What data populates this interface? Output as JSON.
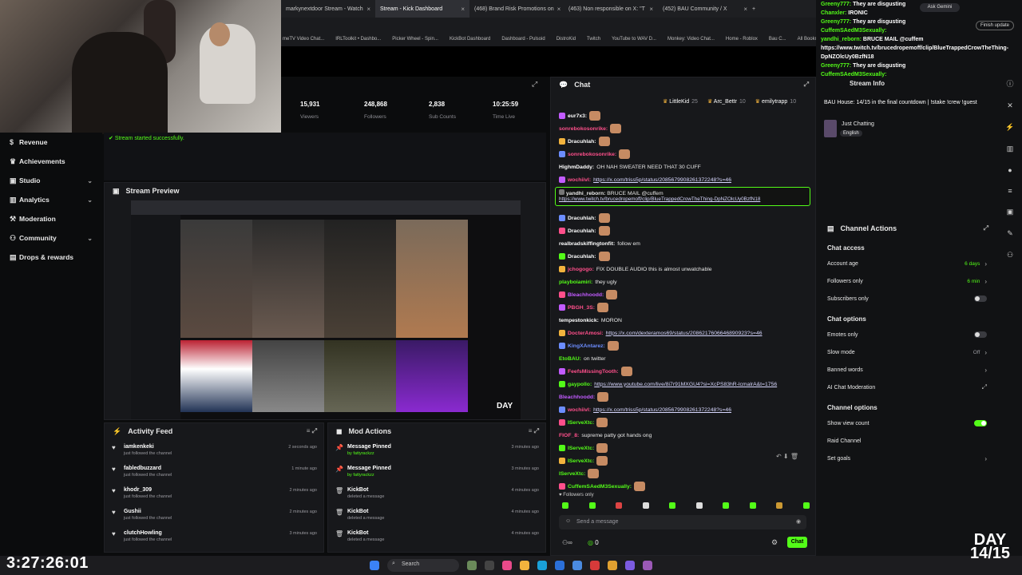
{
  "browser": {
    "tabs": [
      {
        "label": "markynextdoor Stream - Watch",
        "active": false
      },
      {
        "label": "Stream - Kick Dashboard",
        "active": true
      },
      {
        "label": "(468) Brand Risk Promotions on",
        "active": false
      },
      {
        "label": "(463) Non responsible on X: \"T",
        "active": false
      },
      {
        "label": "(452) BAU Community / X",
        "active": false
      }
    ],
    "bookmarks": [
      "meTV Video Chat...",
      "IRLToolkit • Dashbo...",
      "Picker Wheel - Spin...",
      "KickBot Dashboard",
      "Dashboard - Pulsoid",
      "DistroKid",
      "Twitch",
      "YouTube to WAV D...",
      "Monkey: Video Chat...",
      "Home - Roblox",
      "Bau C...",
      "All Bookmarks"
    ],
    "ask_gemini": "Ask Gemini",
    "finish_update": "Finish update"
  },
  "sidebar": {
    "items": [
      {
        "label": "Revenue",
        "icon": "dollar-icon",
        "chevron": false
      },
      {
        "label": "Achievements",
        "icon": "trophy-icon",
        "chevron": false
      },
      {
        "label": "Studio",
        "icon": "studio-icon",
        "chevron": true
      },
      {
        "label": "Analytics",
        "icon": "chart-icon",
        "chevron": true
      },
      {
        "label": "Moderation",
        "icon": "hammer-icon",
        "chevron": false
      },
      {
        "label": "Community",
        "icon": "people-icon",
        "chevron": true
      },
      {
        "label": "Drops & rewards",
        "icon": "gift-icon",
        "chevron": false
      }
    ]
  },
  "stats": [
    {
      "value": "15,931",
      "label": "Viewers"
    },
    {
      "value": "248,868",
      "label": "Followers"
    },
    {
      "value": "2,838",
      "label": "Sub Counts"
    },
    {
      "value": "10:25:59",
      "label": "Time Live"
    }
  ],
  "toast": "Stream started successfully.",
  "preview": {
    "title": "Stream Preview",
    "day": "DAY"
  },
  "activity": {
    "title": "Activity Feed",
    "items": [
      {
        "name": "iamkenkeki",
        "sub": "just followed the channel",
        "time": "2 seconds ago"
      },
      {
        "name": "fabledbuzzard",
        "sub": "just followed the channel",
        "time": "1 minute ago"
      },
      {
        "name": "khodr_309",
        "sub": "just followed the channel",
        "time": "2 minutes ago"
      },
      {
        "name": "Gushii",
        "sub": "just followed the channel",
        "time": "2 minutes ago"
      },
      {
        "name": "clutchHowling",
        "sub": "just followed the channel",
        "time": "3 minutes ago"
      }
    ]
  },
  "mod": {
    "title": "Mod Actions",
    "items": [
      {
        "name": "Message Pinned",
        "sub": "by fattyrackzz",
        "time": "3 minutes ago",
        "icon": "pin-icon",
        "subgreen": true
      },
      {
        "name": "Message Pinned",
        "sub": "by fattyrackzz",
        "time": "3 minutes ago",
        "icon": "pin-icon",
        "subgreen": true
      },
      {
        "name": "KickBot",
        "sub": "deleted a message",
        "time": "4 minutes ago",
        "icon": "trash-icon",
        "subgreen": false
      },
      {
        "name": "KickBot",
        "sub": "deleted a message",
        "time": "4 minutes ago",
        "icon": "trash-icon",
        "subgreen": false
      },
      {
        "name": "KickBot",
        "sub": "deleted a message",
        "time": "4 minutes ago",
        "icon": "trash-icon",
        "subgreen": false
      }
    ]
  },
  "chat": {
    "title": "Chat",
    "top_users": [
      {
        "name": "LittleKid",
        "count": "25"
      },
      {
        "name": "Arc_Bettr",
        "count": "10"
      },
      {
        "name": "emilytrapp",
        "count": "10"
      }
    ],
    "messages": [
      {
        "user": "eur7x3:",
        "color": "#ffffff",
        "text": "",
        "emoji": true
      },
      {
        "user": "sonrebokosonrike:",
        "color": "#ff4f8b",
        "text": "",
        "emoji": true
      },
      {
        "user": "Dracuhlah:",
        "color": "#ffffff",
        "text": "",
        "emoji": true
      },
      {
        "user": "sonrebokosonrike:",
        "color": "#ff4f8b",
        "text": "",
        "emoji": true
      },
      {
        "user": "HighmDaddy:",
        "color": "#ffffff",
        "text": "OH NAH SWEATER NEED THAT 30 CUFF",
        "emoji": false
      },
      {
        "user": "wochiivl:",
        "color": "#ff4f8b",
        "text": "https://x.com/triss5p/status/2085679908261372248?s=46",
        "link": true
      },
      {
        "user": "",
        "color": "#ffffff",
        "text": "",
        "spacer": true
      },
      {
        "user": "",
        "color": "#ffffff",
        "text": "",
        "spacer": true
      },
      {
        "user": "Dracuhlah:",
        "color": "#ffffff",
        "text": "",
        "emoji": true
      },
      {
        "user": "Dracuhlah:",
        "color": "#ffffff",
        "text": "",
        "emoji": true
      },
      {
        "user": "realbradskiffingtonfit:",
        "color": "#ffffff",
        "text": "follow em"
      },
      {
        "user": "Dracuhlah:",
        "color": "#ffffff",
        "text": "",
        "emoji": true
      },
      {
        "user": "jchogogo:",
        "color": "#ff4f8b",
        "text": "FIX DOUBLE AUDIO this is almost unwatchable"
      },
      {
        "user": "playboiamiri:",
        "color": "#53fc18",
        "text": "they ugly"
      },
      {
        "user": "Bleachhoodd:",
        "color": "#c25bff",
        "text": "",
        "emoji": true
      },
      {
        "user": "PBGH_3S:",
        "color": "#ff4f8b",
        "text": "",
        "emoji": true
      },
      {
        "user": "tempestonkick:",
        "color": "#ffffff",
        "text": "MORON"
      },
      {
        "user": "DocterAmosi:",
        "color": "#ff4f8b",
        "text": "https://x.com/dexteramos69/status/2086217606646890923?s=46",
        "link": true
      },
      {
        "user": "KingXAntarez:",
        "color": "#6c8dff",
        "text": "",
        "emoji": true
      },
      {
        "user": "EtoBAU:",
        "color": "#53fc18",
        "text": "on twitter"
      },
      {
        "user": "FeefsMissingTooth:",
        "color": "#ff4f8b",
        "text": "",
        "emoji": true
      },
      {
        "user": "gaypollo:",
        "color": "#53fc18",
        "text": "https://www.youtube.com/live/8i7r91MXGU4?si=XcPS83hR-lcmalrA&t=1756",
        "link": true
      },
      {
        "user": "Bleachhoodd:",
        "color": "#c25bff",
        "text": "",
        "emoji": true
      },
      {
        "user": "wochiivl:",
        "color": "#ff4f8b",
        "text": "https://x.com/triss5p/status/2085679908261372248?s=46",
        "link": true
      },
      {
        "user": "IServeXtc:",
        "color": "#53fc18",
        "text": "",
        "emoji": true
      },
      {
        "user": "FIOF_8:",
        "color": "#ff4f8b",
        "text": "supreme patty got hands ong"
      },
      {
        "user": "IServeXtc:",
        "color": "#53fc18",
        "text": "",
        "emoji": true
      },
      {
        "user": "IServeXtc:",
        "color": "#53fc18",
        "text": "",
        "emoji": true
      },
      {
        "user": "IServeXtc:",
        "color": "#53fc18",
        "text": "",
        "emoji": true
      },
      {
        "user": "CuffemSAedM3Sexually:",
        "color": "#53fc18",
        "text": "",
        "emoji": true
      }
    ],
    "pinned": {
      "user": "yandhi_reborn:",
      "text": "BRUCE MAIL @cuffem",
      "link": "https://www.twitch.tv/brucedropemoff/clip/BlueTrappedCrowTheThing-DpNZOlcUy0BzfN18"
    },
    "followers_only": "Followers only",
    "input_placeholder": "Send a message",
    "count": "0",
    "send_label": "Chat"
  },
  "stream_info": {
    "title": "Stream Info",
    "desc": "BAU House: 14/15 in the final countdown | !stake !crew !guest",
    "category": "Just Chatting",
    "lang": "English"
  },
  "overlay_chat": [
    {
      "user": "Greeny777:",
      "text": "They are disgusting"
    },
    {
      "user": "Chanxler:",
      "text": "IRONIC"
    },
    {
      "user": "Greeny777:",
      "text": "They are disgusting"
    },
    {
      "user": "CuffemSAedM3Sexually:",
      "text": ""
    },
    {
      "user": "yandhi_reborn:",
      "text": "BRUCE MAIL @cuffem"
    },
    {
      "user": "",
      "text": "https://www.twitch.tv/brucedropemoff/clip/BlueTrappedCrowTheThing-"
    },
    {
      "user": "",
      "text": "DpNZOlcUy0BzfN18"
    },
    {
      "user": "Greeny777:",
      "text": "They are disgusting"
    },
    {
      "user": "CuffemSAedM3Sexually:",
      "text": ""
    }
  ],
  "channel_actions": {
    "title": "Channel Actions",
    "access_title": "Chat access",
    "account_age": {
      "label": "Account age",
      "value": "6 days"
    },
    "followers_only": {
      "label": "Followers only",
      "value": "6 min"
    },
    "subscribers_only": {
      "label": "Subscribers only"
    },
    "options_title": "Chat options",
    "emotes_only": {
      "label": "Emotes only"
    },
    "slow_mode": {
      "label": "Slow mode",
      "value": "Off"
    },
    "banned_words": {
      "label": "Banned words"
    },
    "ai_mod": {
      "label": "AI Chat Moderation"
    },
    "channel_options_title": "Channel options",
    "show_view_count": {
      "label": "Show view count"
    },
    "raid": {
      "label": "Raid Channel"
    },
    "set_goals": {
      "label": "Set goals"
    }
  },
  "clock": "3:27:26:01",
  "day_overlay": "DAY 14/15",
  "taskbar_search": "Search"
}
